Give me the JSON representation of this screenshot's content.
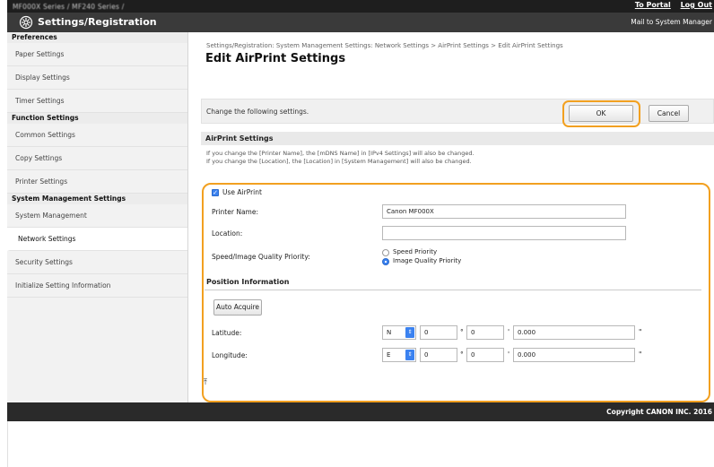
{
  "topbar": {
    "crumb": "MF000X Series / MF240 Series /",
    "portal_link": "To Portal",
    "logout_link": "Log Out"
  },
  "titlebar": {
    "title": "Settings/Registration",
    "mail_link": "Mail to System Manager"
  },
  "sidebar": {
    "groups": [
      {
        "head": "Preferences",
        "items": [
          "Paper Settings",
          "Display Settings",
          "Timer Settings"
        ]
      },
      {
        "head": "Function Settings",
        "items": [
          "Common Settings",
          "Copy Settings",
          "Printer Settings"
        ]
      },
      {
        "head": "System Management Settings",
        "items": [
          "System Management",
          "Network Settings",
          "Security Settings",
          "Initialize Setting Information"
        ]
      }
    ],
    "active": "Network Settings"
  },
  "main": {
    "breadcrumb": "Settings/Registration: System Management Settings: Network Settings > AirPrint Settings > Edit AirPrint Settings",
    "title": "Edit AirPrint Settings",
    "instruction": "Change the following settings.",
    "ok_label": "OK",
    "cancel_label": "Cancel",
    "section_title": "AirPrint Settings",
    "note_line1": "If you change the [Printer Name], the [mDNS Name] in [IPv4 Settings] will also be changed.",
    "note_line2": "If you change the [Location], the [Location] in [System Management] will also be changed."
  },
  "form": {
    "use_airprint_label": "Use AirPrint",
    "use_airprint_checked": true,
    "printer_name_label": "Printer Name:",
    "printer_name_value": "Canon MF000X",
    "location_label": "Location:",
    "location_value": "",
    "priority_label": "Speed/Image Quality Priority:",
    "priority_options": [
      "Speed Priority",
      "Image Quality Priority"
    ],
    "priority_selected": "Image Quality Priority",
    "position_head": "Position Information",
    "auto_acquire_label": "Auto Acquire",
    "latitude_label": "Latitude:",
    "latitude_dir": "N",
    "latitude_deg": "0",
    "latitude_min": "0",
    "latitude_sec": "0.000",
    "longitude_label": "Longitude:",
    "longitude_dir": "E",
    "longitude_deg": "0",
    "longitude_min": "0",
    "longitude_sec": "0.000",
    "deg_sym": "°",
    "min_sym": "'",
    "sec_sym": "\""
  },
  "to_top_glyph": "⤒",
  "footer": {
    "copyright": "Copyright CANON INC. 2016"
  },
  "colors": {
    "highlight": "#f2a020",
    "accent": "#3b82f0"
  }
}
